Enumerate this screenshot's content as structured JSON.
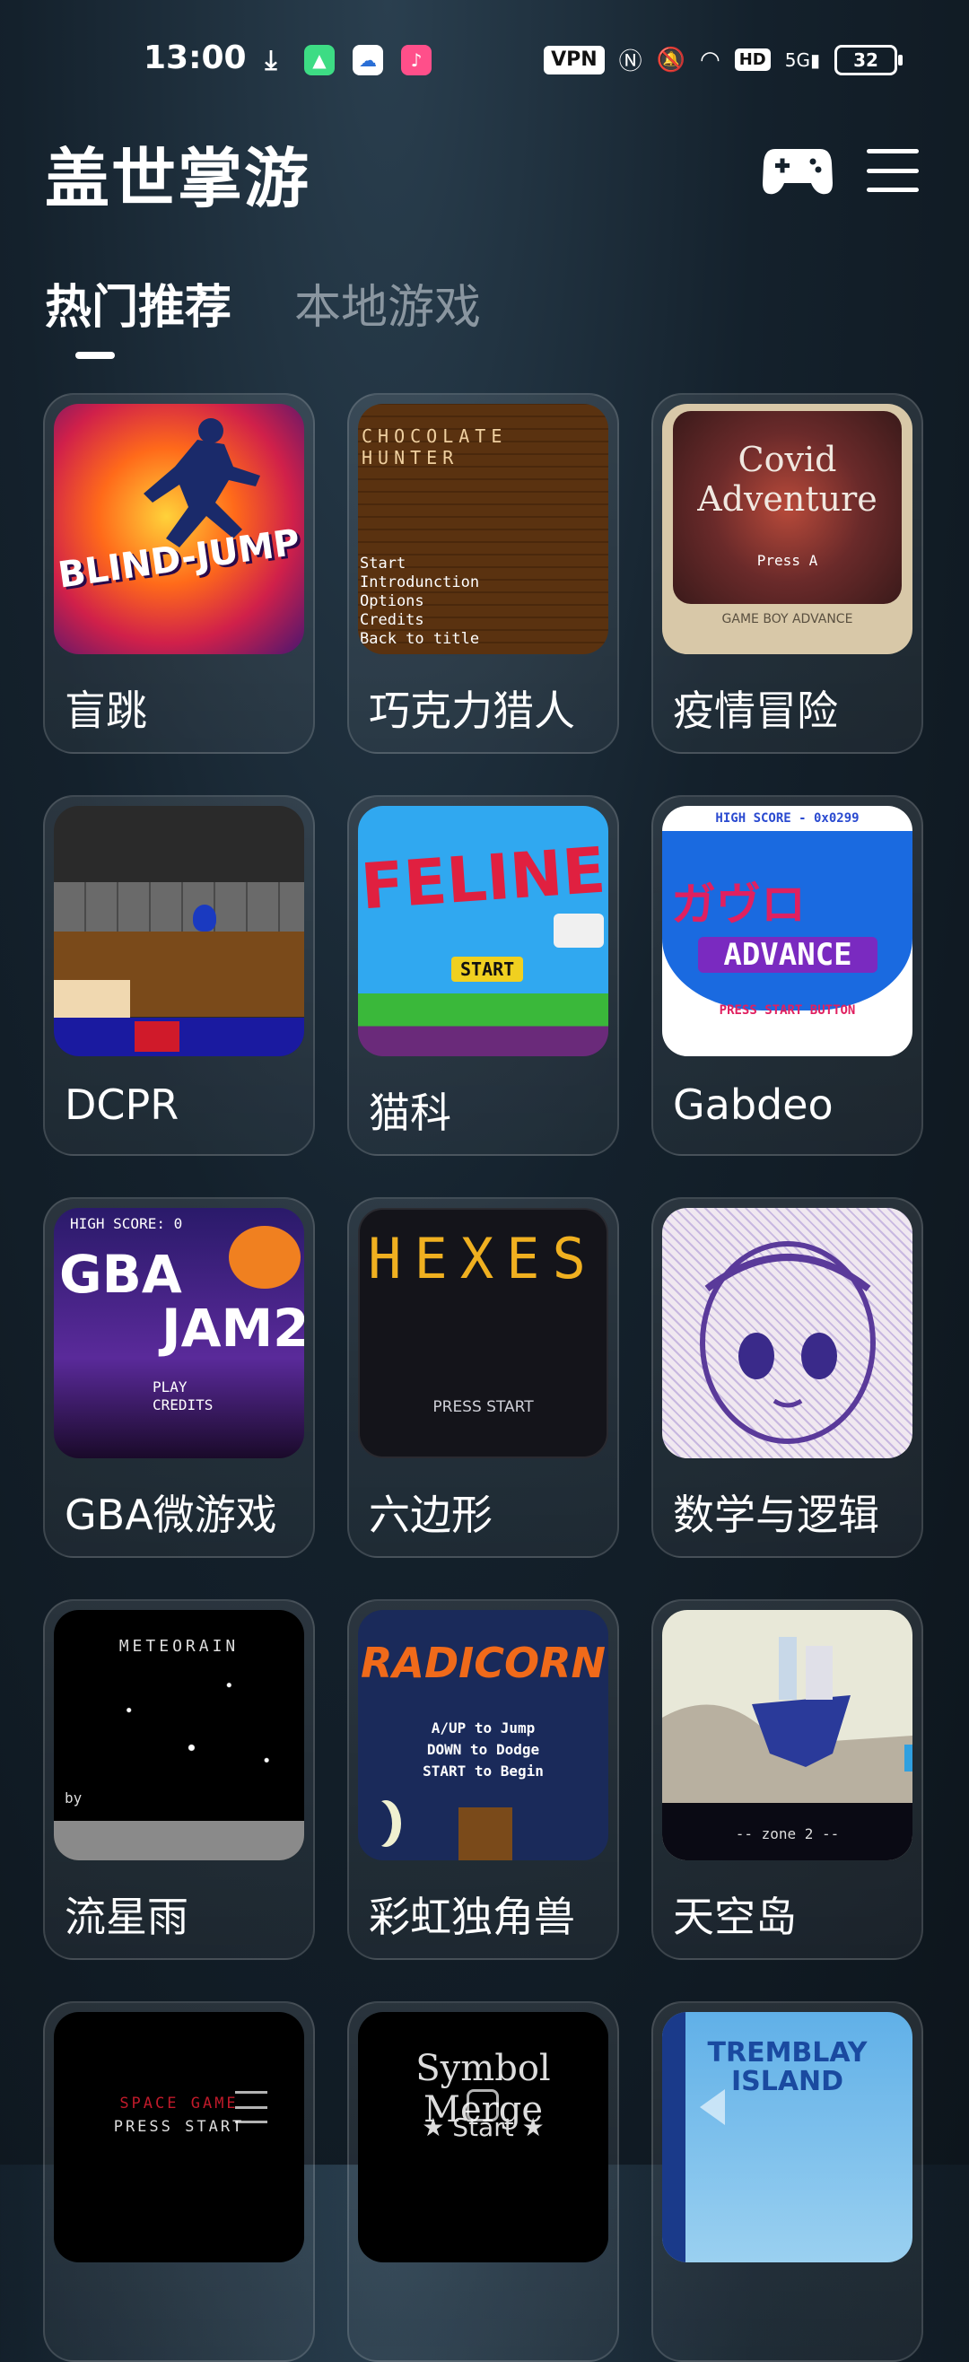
{
  "status_bar": {
    "time": "13:00",
    "vpn": "VPN",
    "hd": "HD",
    "signal": "5G",
    "battery": "32"
  },
  "app": {
    "title": "盖世掌游"
  },
  "tabs": [
    {
      "label": "热门推荐",
      "active": true
    },
    {
      "label": "本地游戏",
      "active": false
    }
  ],
  "games": [
    {
      "name": "盲跳",
      "thumb_text": "BLIND-JUMP"
    },
    {
      "name": "巧克力猎人",
      "thumb_text": "CHOCOLATE HUNTER",
      "menu": [
        "Start",
        "Introdunction",
        "Options",
        "Credits",
        "Back to title"
      ]
    },
    {
      "name": "疫情冒险",
      "thumb_text": "Covid Adventure",
      "sub": "Press A",
      "brand": "GAME BOY ADVANCE"
    },
    {
      "name": "DCPR"
    },
    {
      "name": "猫科",
      "thumb_text": "FELINE",
      "sub": "START"
    },
    {
      "name": "Gabdeo",
      "thumb_text": "ADVANCE",
      "top": "HIGH SCORE - 0x0299",
      "bottom": "PRESS START BUTTON"
    },
    {
      "name": "GBA微游戏",
      "top": "HIGH SCORE: 0",
      "thumb_text": "GBA",
      "line2": "JAM2",
      "menu": [
        "PLAY",
        "CREDITS"
      ]
    },
    {
      "name": "六边形",
      "thumb_text": "HEXES",
      "sub": "PRESS START"
    },
    {
      "name": "数学与逻辑"
    },
    {
      "name": "流星雨",
      "thumb_text": "METEORAIN",
      "sub": "by"
    },
    {
      "name": "彩虹独角兽",
      "thumb_text": "RADICORN",
      "menu": [
        "A/UP to Jump",
        "DOWN to Dodge",
        "START to Begin"
      ]
    },
    {
      "name": "天空岛",
      "sub": "-- zone 2 --"
    },
    {
      "name": "",
      "thumb_text": "SPACE GAME",
      "sub": "PRESS START"
    },
    {
      "name": "",
      "thumb_text": "Symbol Merge",
      "sub": "Start"
    },
    {
      "name": "",
      "thumb_text": "TREMBLAY ISLAND"
    }
  ],
  "colors": {
    "accent": "#ffffff",
    "inactive_tab": "#8a96a0",
    "background": "#14212c"
  }
}
